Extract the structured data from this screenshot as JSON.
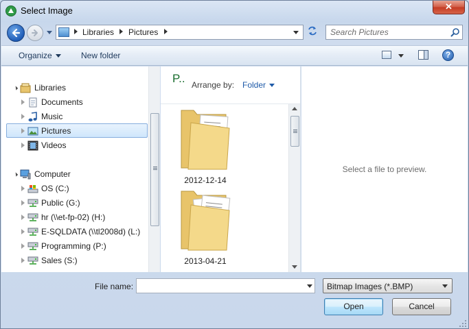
{
  "window": {
    "title": "Select Image",
    "close_label": "✕"
  },
  "address": {
    "segments": [
      "Libraries",
      "Pictures"
    ]
  },
  "search": {
    "placeholder": "Search Pictures"
  },
  "toolbar": {
    "organize_label": "Organize",
    "new_folder_label": "New folder",
    "help_label": "?"
  },
  "nav": {
    "items": [
      {
        "label": "Libraries",
        "level": 0,
        "expander": "open",
        "icon": "libraries-icon"
      },
      {
        "label": "Documents",
        "level": 1,
        "expander": "closed",
        "icon": "documents-icon"
      },
      {
        "label": "Music",
        "level": 1,
        "expander": "closed",
        "icon": "music-icon"
      },
      {
        "label": "Pictures",
        "level": 1,
        "expander": "closed",
        "icon": "pictures-icon",
        "selected": true
      },
      {
        "label": "Videos",
        "level": 1,
        "expander": "closed",
        "icon": "videos-icon"
      },
      {
        "label": "Computer",
        "level": 0,
        "expander": "open",
        "icon": "computer-icon"
      },
      {
        "label": "OS (C:)",
        "level": 1,
        "expander": "closed",
        "icon": "local-drive-icon"
      },
      {
        "label": "Public (G:)",
        "level": 1,
        "expander": "closed",
        "icon": "network-drive-icon"
      },
      {
        "label": "hr (\\\\et-fp-02) (H:)",
        "level": 1,
        "expander": "closed",
        "icon": "network-drive-icon"
      },
      {
        "label": "E-SQLDATA (\\\\tl2008d) (L:)",
        "level": 1,
        "expander": "closed",
        "icon": "network-drive-icon"
      },
      {
        "label": "Programming (P:)",
        "level": 1,
        "expander": "closed",
        "icon": "network-drive-icon"
      },
      {
        "label": "Sales (S:)",
        "level": 1,
        "expander": "closed",
        "icon": "network-drive-icon"
      }
    ]
  },
  "content": {
    "library_title": "P..",
    "arrange_label": "Arrange by:",
    "arrange_value": "Folder",
    "folders": [
      {
        "name": "2012-12-14"
      },
      {
        "name": "2013-04-21"
      }
    ]
  },
  "preview": {
    "message": "Select a file to preview."
  },
  "footer": {
    "filename_label": "File name:",
    "filename_value": "",
    "filetype_value": "Bitmap Images (*.BMP)",
    "open_label": "Open",
    "cancel_label": "Cancel"
  },
  "colors": {
    "accent": "#1e5aa8",
    "library_title": "#1a6e2f",
    "selection": "#cfe6fc"
  }
}
